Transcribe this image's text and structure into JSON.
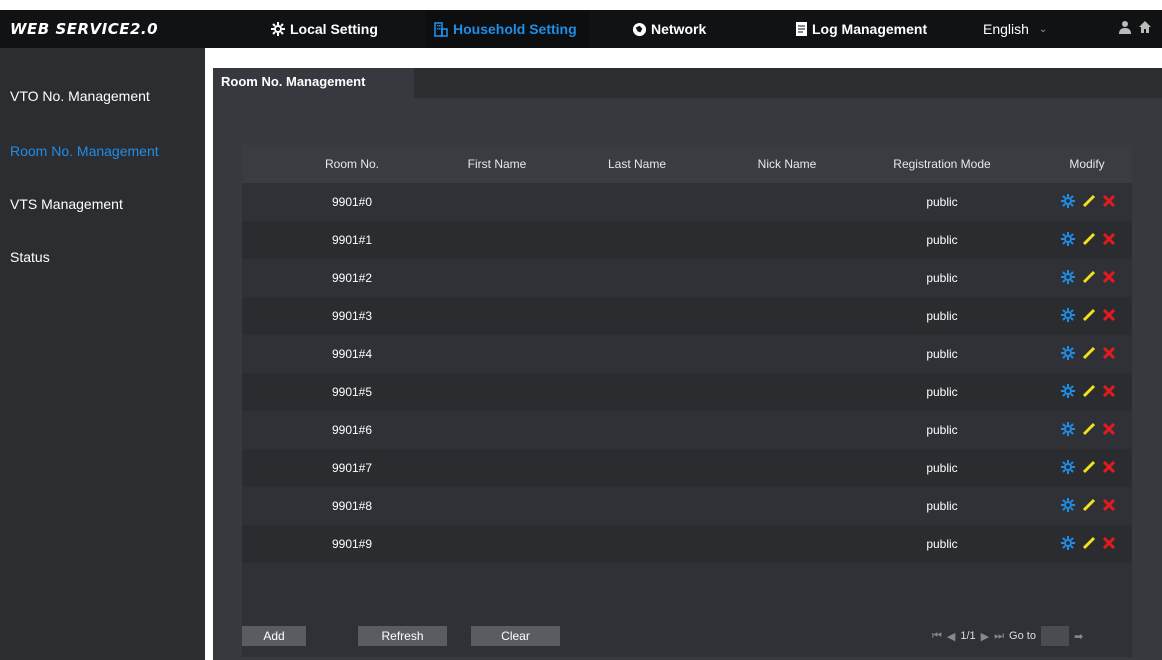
{
  "header": {
    "logo": "WEB SERVICE2.0",
    "nav": [
      {
        "label": "Local Setting"
      },
      {
        "label": "Household Setting"
      },
      {
        "label": "Network"
      },
      {
        "label": "Log Management"
      }
    ],
    "language": "English"
  },
  "sidebar": {
    "items": [
      {
        "label": "VTO No. Management"
      },
      {
        "label": "Room No. Management"
      },
      {
        "label": "VTS Management"
      },
      {
        "label": "Status"
      }
    ]
  },
  "main": {
    "tab": "Room No. Management",
    "columns": [
      "Room No.",
      "First Name",
      "Last Name",
      "Nick Name",
      "Registration Mode",
      "Modify"
    ],
    "rows": [
      {
        "room": "9901#0",
        "first": "",
        "last": "",
        "nick": "",
        "mode": "public"
      },
      {
        "room": "9901#1",
        "first": "",
        "last": "",
        "nick": "",
        "mode": "public"
      },
      {
        "room": "9901#2",
        "first": "",
        "last": "",
        "nick": "",
        "mode": "public"
      },
      {
        "room": "9901#3",
        "first": "",
        "last": "",
        "nick": "",
        "mode": "public"
      },
      {
        "room": "9901#4",
        "first": "",
        "last": "",
        "nick": "",
        "mode": "public"
      },
      {
        "room": "9901#5",
        "first": "",
        "last": "",
        "nick": "",
        "mode": "public"
      },
      {
        "room": "9901#6",
        "first": "",
        "last": "",
        "nick": "",
        "mode": "public"
      },
      {
        "room": "9901#7",
        "first": "",
        "last": "",
        "nick": "",
        "mode": "public"
      },
      {
        "room": "9901#8",
        "first": "",
        "last": "",
        "nick": "",
        "mode": "public"
      },
      {
        "room": "9901#9",
        "first": "",
        "last": "",
        "nick": "",
        "mode": "public"
      }
    ],
    "buttons": {
      "add": "Add",
      "refresh": "Refresh",
      "clear": "Clear"
    },
    "pager": {
      "page": "1/1",
      "goto_label": "Go to"
    }
  },
  "icons": {
    "modify": [
      "gear-icon",
      "pencil-icon",
      "delete-icon"
    ],
    "colors": {
      "accent": "#1e8ee8",
      "edit": "#f5e11a",
      "delete": "#e8191e"
    }
  }
}
